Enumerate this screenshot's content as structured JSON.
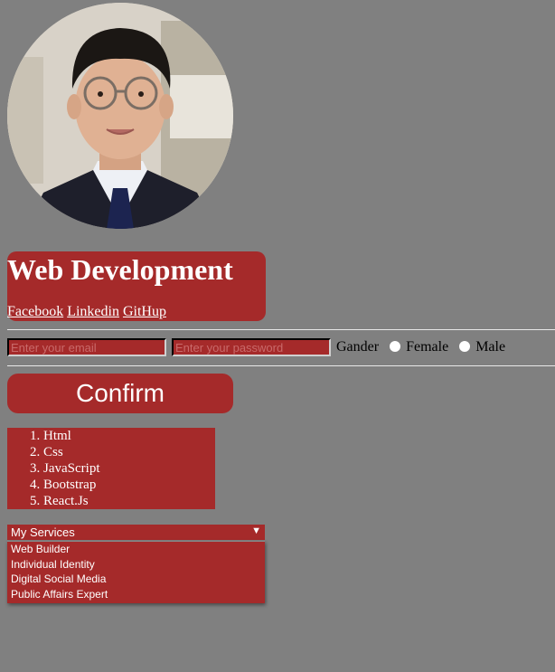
{
  "profile": {
    "photo_icon": "profile-photo"
  },
  "header": {
    "title": "Web Development",
    "links": [
      "Facebook",
      "Linkedin",
      "GitHup"
    ]
  },
  "form": {
    "email_placeholder": "Enter your email",
    "password_placeholder": "Enter your password",
    "gender_label": "Gander",
    "female_label": "Female",
    "male_label": "Male"
  },
  "confirm_label": "Confirm",
  "skills": [
    "Html",
    "Css",
    "JavaScript",
    "Bootstrap",
    "React.Js"
  ],
  "services": {
    "selected": "My Services",
    "options": [
      "Web Builder",
      "Individual Identity",
      "Digital Social Media",
      "Public Affairs Expert"
    ]
  },
  "colors": {
    "background": "#808080",
    "accent": "#a52a2a",
    "text_light": "#ffffff"
  }
}
